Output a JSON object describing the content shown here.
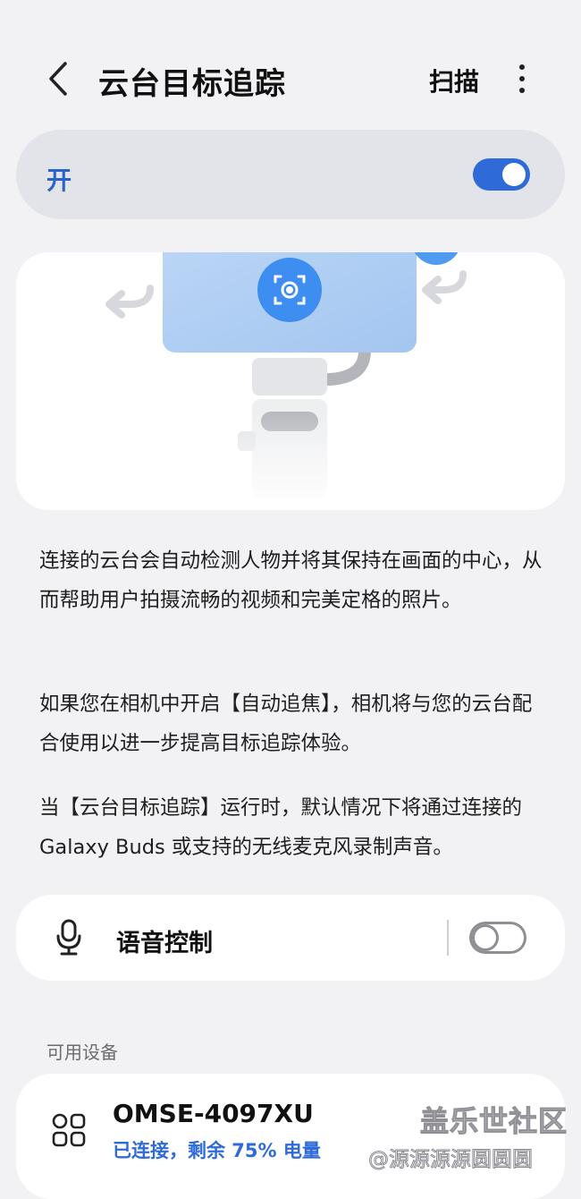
{
  "header": {
    "back_icon": "chevron-left-icon",
    "title": "云台目标追踪",
    "scan_label": "扫描",
    "more_icon": "more-vertical-icon"
  },
  "master": {
    "label": "开",
    "enabled": true,
    "accent": "#2f6bd8"
  },
  "description": {
    "p1": "连接的云台会自动检测人物并将其保持在画面的中心，从而帮助用户拍摄流畅的视频和完美定格的照片。",
    "p2": "如果您在相机中开启【自动追焦】，相机将与您的云台配合使用以进一步提高目标追踪体验。",
    "p3": "当【云台目标追踪】运行时，默认情况下将通过连接的 Galaxy Buds 或支持的无线麦克风录制声音。"
  },
  "voice_control": {
    "icon": "microphone-icon",
    "label": "语音控制",
    "enabled": false
  },
  "devices": {
    "section_title": "可用设备",
    "items": [
      {
        "icon": "device-grid-icon",
        "name": "OMSE-4097XU",
        "status": "已连接，剩余 75% 电量"
      }
    ]
  },
  "watermark": {
    "line1": "盖乐世社区",
    "line2": "@源源源源圆圆圆"
  }
}
